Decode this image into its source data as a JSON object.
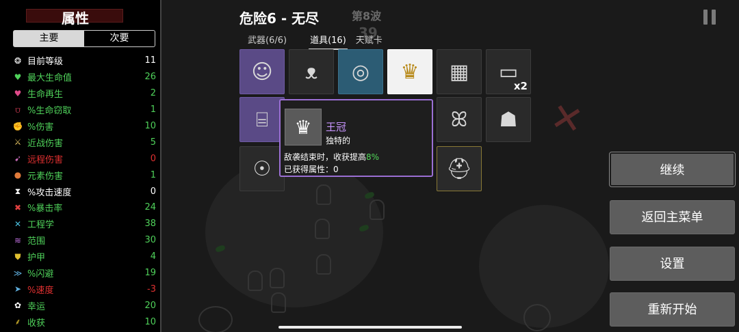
{
  "stats": {
    "title": "属性",
    "tabs": [
      {
        "label": "主要",
        "active": true
      },
      {
        "label": "次要",
        "active": false
      }
    ],
    "rows": [
      {
        "icon": "level-icon",
        "glyph": "❂",
        "glyph_color": "#ffffff",
        "label": "目前等级",
        "value": "11",
        "label_color": "#ffffff",
        "value_color": "#ffffff"
      },
      {
        "icon": "heart-icon",
        "glyph": "♥",
        "glyph_color": "#4fd15a",
        "label": "最大生命值",
        "value": "26",
        "label_color": "#4fd15a",
        "value_color": "#4fd15a"
      },
      {
        "icon": "regen-heart-icon",
        "glyph": "♥",
        "glyph_color": "#e04a8a",
        "label": "生命再生",
        "value": "2",
        "label_color": "#4fd15a",
        "value_color": "#4fd15a"
      },
      {
        "icon": "teeth-icon",
        "glyph": "⩌",
        "glyph_color": "#e0405a",
        "label": "%生命窃取",
        "value": "1",
        "label_color": "#4fd15a",
        "value_color": "#4fd15a"
      },
      {
        "icon": "fist-icon",
        "glyph": "✊",
        "glyph_color": "#e04a4a",
        "label": "%伤害",
        "value": "10",
        "label_color": "#4fd15a",
        "value_color": "#4fd15a"
      },
      {
        "icon": "sword-icon",
        "glyph": "⚔",
        "glyph_color": "#e0c060",
        "label": "近战伤害",
        "value": "5",
        "label_color": "#4fd15a",
        "value_color": "#4fd15a"
      },
      {
        "icon": "bow-icon",
        "glyph": "➹",
        "glyph_color": "#d070c0",
        "label": "远程伤害",
        "value": "0",
        "label_color": "#e03030",
        "value_color": "#e03030"
      },
      {
        "icon": "flame-icon",
        "glyph": "●",
        "glyph_color": "#e07a3a",
        "label": "元素伤害",
        "value": "1",
        "label_color": "#4fd15a",
        "value_color": "#4fd15a"
      },
      {
        "icon": "hourglass-icon",
        "glyph": "⧗",
        "glyph_color": "#ffffff",
        "label": "%攻击速度",
        "value": "0",
        "label_color": "#ffffff",
        "value_color": "#ffffff"
      },
      {
        "icon": "crit-icon",
        "glyph": "✖",
        "glyph_color": "#e04040",
        "label": "%暴击率",
        "value": "24",
        "label_color": "#4fd15a",
        "value_color": "#4fd15a"
      },
      {
        "icon": "wrench-icon",
        "glyph": "✕",
        "glyph_color": "#4ac0e0",
        "label": "工程学",
        "value": "38",
        "label_color": "#4fd15a",
        "value_color": "#4fd15a"
      },
      {
        "icon": "range-icon",
        "glyph": "≋",
        "glyph_color": "#c070e0",
        "label": "范围",
        "value": "30",
        "label_color": "#4fd15a",
        "value_color": "#4fd15a"
      },
      {
        "icon": "shield-icon",
        "glyph": "⛊",
        "glyph_color": "#e0c030",
        "label": "护甲",
        "value": "4",
        "label_color": "#4fd15a",
        "value_color": "#4fd15a"
      },
      {
        "icon": "dodge-icon",
        "glyph": "≫",
        "glyph_color": "#60b0e0",
        "label": "%闪避",
        "value": "19",
        "label_color": "#4fd15a",
        "value_color": "#4fd15a"
      },
      {
        "icon": "boot-icon",
        "glyph": "➤",
        "glyph_color": "#60b0e0",
        "label": "%速度",
        "value": "-3",
        "label_color": "#e03030",
        "value_color": "#e03030"
      },
      {
        "icon": "luck-icon",
        "glyph": "✿",
        "glyph_color": "#ffffff",
        "label": "幸运",
        "value": "20",
        "label_color": "#4fd15a",
        "value_color": "#4fd15a"
      },
      {
        "icon": "harvest-icon",
        "glyph": "⸙",
        "glyph_color": "#e0c030",
        "label": "收获",
        "value": "10",
        "label_color": "#4fd15a",
        "value_color": "#4fd15a"
      }
    ]
  },
  "header": {
    "title": "危险6 - 无尽",
    "wave": "第8波",
    "timer": "39"
  },
  "inventory": {
    "tabs": [
      {
        "label": "武器(6/6)",
        "active": false
      },
      {
        "label": "道具(16)",
        "active": true
      },
      {
        "label": "天赋卡",
        "active": false
      }
    ],
    "slots": [
      {
        "name": "mummy-item-icon",
        "glyph": "☺",
        "style": "unique",
        "count": ""
      },
      {
        "name": "scarf-item-icon",
        "glyph": "ᴥ",
        "style": "",
        "count": ""
      },
      {
        "name": "ring-item-icon",
        "glyph": "◎",
        "style": "blue",
        "count": ""
      },
      {
        "name": "crown-item-icon",
        "glyph": "♛",
        "style": "white",
        "count": ""
      },
      {
        "name": "plaid-shirt-item-icon",
        "glyph": "▦",
        "style": "",
        "count": ""
      },
      {
        "name": "cash-item-icon",
        "glyph": "▭",
        "style": "",
        "count": "x2"
      },
      {
        "name": "bandage-item-icon",
        "glyph": "⌸",
        "style": "unique",
        "count": ""
      },
      {
        "name": "butterfly-item-icon",
        "glyph": "ꕤ",
        "style": "",
        "count": ""
      },
      {
        "name": "tooth-item-icon",
        "glyph": "☗",
        "style": "",
        "count": ""
      },
      {
        "name": "ghost-item-icon",
        "glyph": "☉",
        "style": "",
        "count": ""
      },
      {
        "name": "helmet-item-icon",
        "glyph": "⛑",
        "style": "gold",
        "count": ""
      }
    ]
  },
  "tooltip": {
    "name": "王冠",
    "rarity": "独特的",
    "desc_prefix": "敌袭结束时，收获提高",
    "desc_highlight": "8%",
    "acquired": "已获得属性：0"
  },
  "menu": {
    "continue": "继续",
    "main_menu": "返回主菜单",
    "settings": "设置",
    "restart": "重新开始"
  },
  "colors": {
    "positive": "#4fd15a",
    "negative": "#e03030",
    "unique_item": "#c895ff",
    "button": "#5d5d5d"
  }
}
